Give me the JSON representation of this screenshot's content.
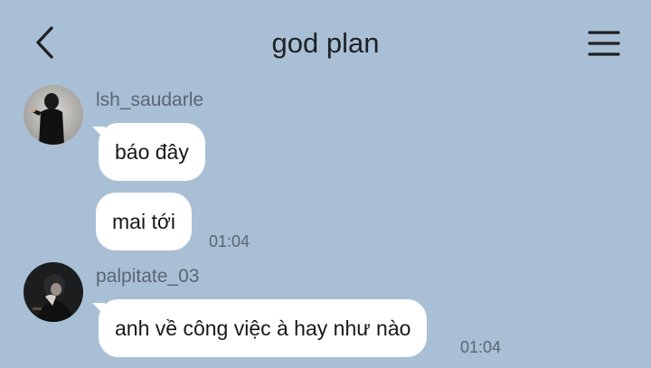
{
  "header": {
    "title": "god plan",
    "back_icon": "chevron-left-icon",
    "menu_icon": "hamburger-menu-icon"
  },
  "messages": [
    {
      "sender": "lsh_saudarle",
      "bubbles": [
        {
          "text": "báo đây",
          "time": ""
        },
        {
          "text": "mai tới",
          "time": "01:04"
        }
      ]
    },
    {
      "sender": "palpitate_03",
      "bubbles": [
        {
          "text": "anh về công việc à hay như nào",
          "time": "01:04"
        }
      ]
    }
  ],
  "colors": {
    "background": "#a9bfd5",
    "bubble": "#ffffff",
    "text": "#16181b",
    "meta_text": "#5a6673"
  }
}
